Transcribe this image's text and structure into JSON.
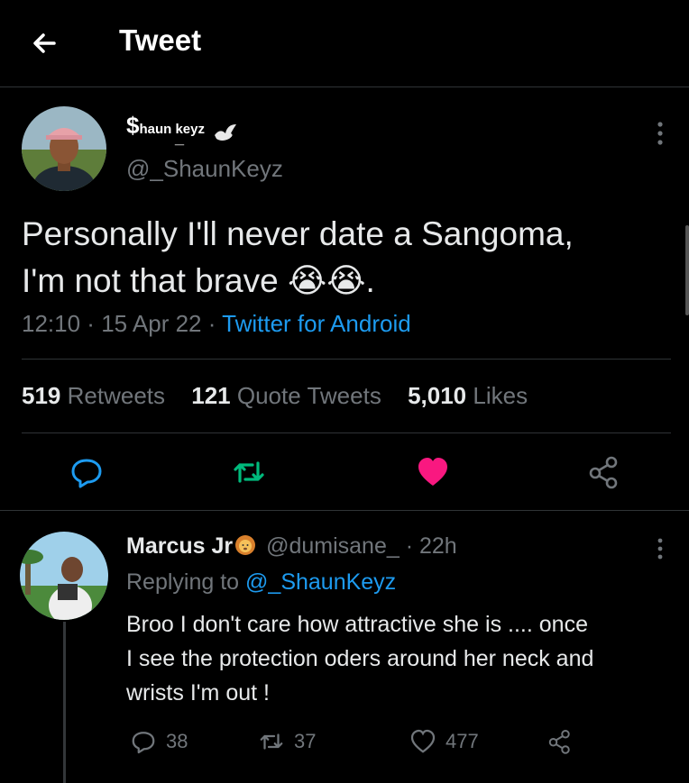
{
  "header": {
    "title": "Tweet"
  },
  "tweet": {
    "display_name_lead": "$",
    "display_name_text": "haun  keyz",
    "display_name_underscore": "_",
    "handle": "@_ShaunKeyz",
    "text_line1": "Personally I'll never date a Sangoma,",
    "text_line2": "I'm not that brave",
    "text_emoji": "😭😭",
    "text_end": ".",
    "time": "12:10",
    "date": "15 Apr 22",
    "source": "Twitter for Android",
    "retweets": "519",
    "retweets_label": "Retweets",
    "quotes": "121",
    "quotes_label": "Quote Tweets",
    "likes": "5,010",
    "likes_label": "Likes",
    "liked": true
  },
  "reply": {
    "name": "Marcus Jr",
    "handle": "@dumisane_",
    "age": "· 22h",
    "replying_prefix": "Replying to",
    "replying_to": "@_ShaunKeyz",
    "text_line1": "Broo I don't care how attractive she is .... once",
    "text_line2": "I see the protection oders around her neck and",
    "text_line3": "wrists I'm out !",
    "replies": "38",
    "retweets": "37",
    "likes": "477"
  },
  "colors": {
    "accent": "#1d9bf0",
    "like": "#f91880",
    "retweet": "#00ba7c",
    "muted": "#71767b"
  },
  "icons": [
    "back-arrow-icon",
    "dove-icon",
    "more-icon",
    "reply-icon",
    "retweet-icon",
    "heart-icon",
    "share-icon",
    "lion-icon"
  ]
}
